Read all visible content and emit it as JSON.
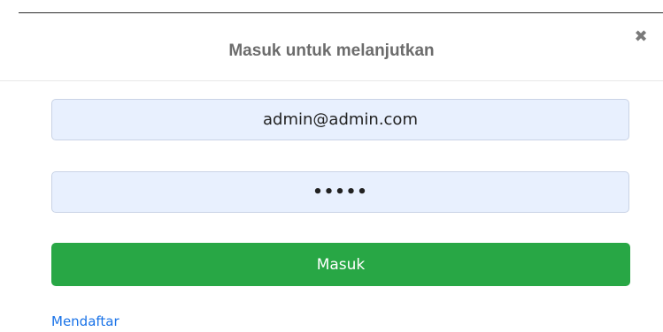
{
  "modal": {
    "title": "Masuk untuk melanjutkan",
    "close_icon": "close-icon",
    "close_glyph": "✖"
  },
  "form": {
    "email_value": "admin@admin.com",
    "password_value": "•••••",
    "submit_label": "Masuk"
  },
  "links": {
    "register_label": "Mendaftar"
  },
  "colors": {
    "primary_button": "#28a745",
    "input_background": "#e8f0fe",
    "link": "#1a73e8"
  }
}
